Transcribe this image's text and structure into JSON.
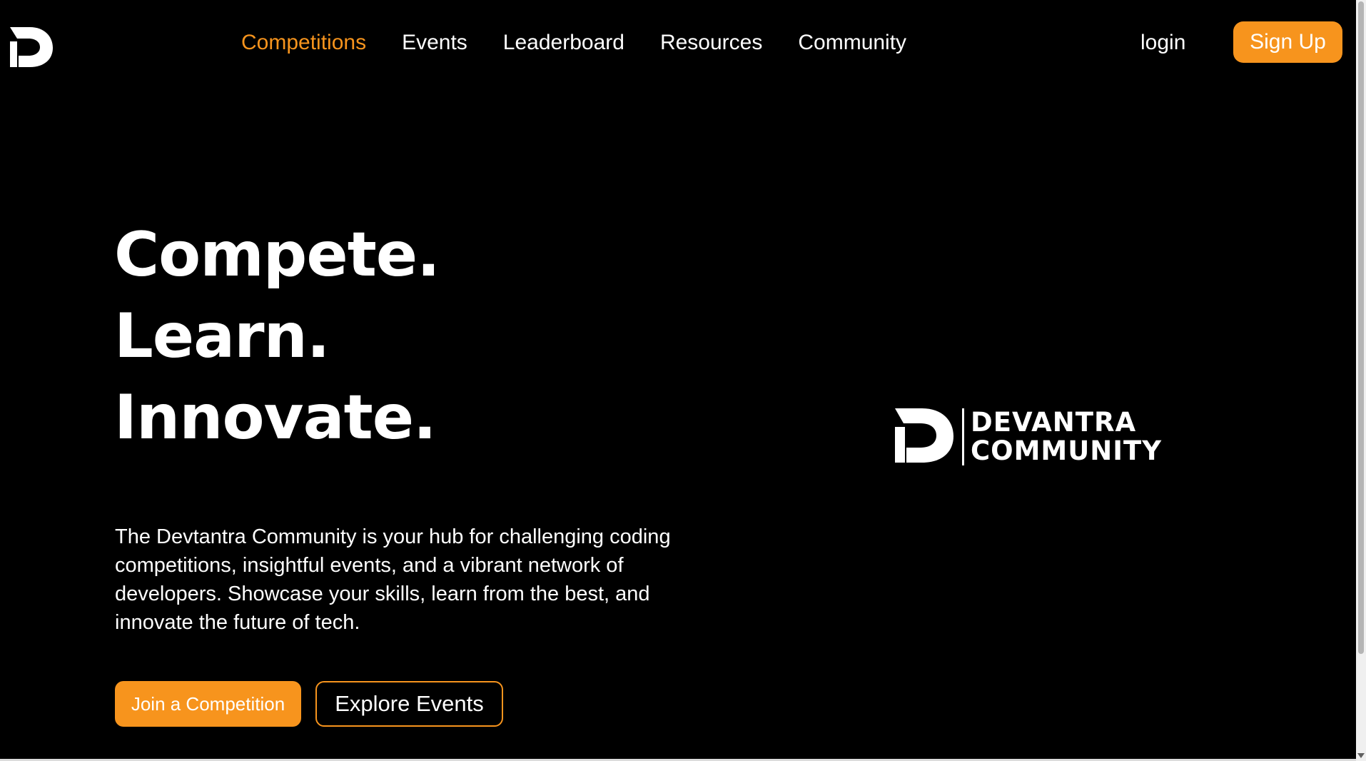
{
  "header": {
    "nav": [
      {
        "label": "Competitions",
        "active": true
      },
      {
        "label": "Events"
      },
      {
        "label": "Leaderboard"
      },
      {
        "label": "Resources"
      },
      {
        "label": "Community"
      }
    ],
    "login_label": "login",
    "signup_label": "Sign Up"
  },
  "hero": {
    "headline": [
      "Compete.",
      "Learn.",
      "Innovate."
    ],
    "description": "The Devtantra Community is your hub for challenging coding competitions, insightful events, and a vibrant network of developers. Showcase your skills, learn from the best, and innovate the future of tech.",
    "primary_button": "Join a Competition",
    "secondary_button": "Explore Events"
  },
  "brand": {
    "line1": "DEVANTRA",
    "line2": "COMMUNITY",
    "icon": "devantra-d-logo"
  },
  "colors": {
    "accent": "#f7941d",
    "background": "#000000",
    "text": "#ffffff"
  }
}
